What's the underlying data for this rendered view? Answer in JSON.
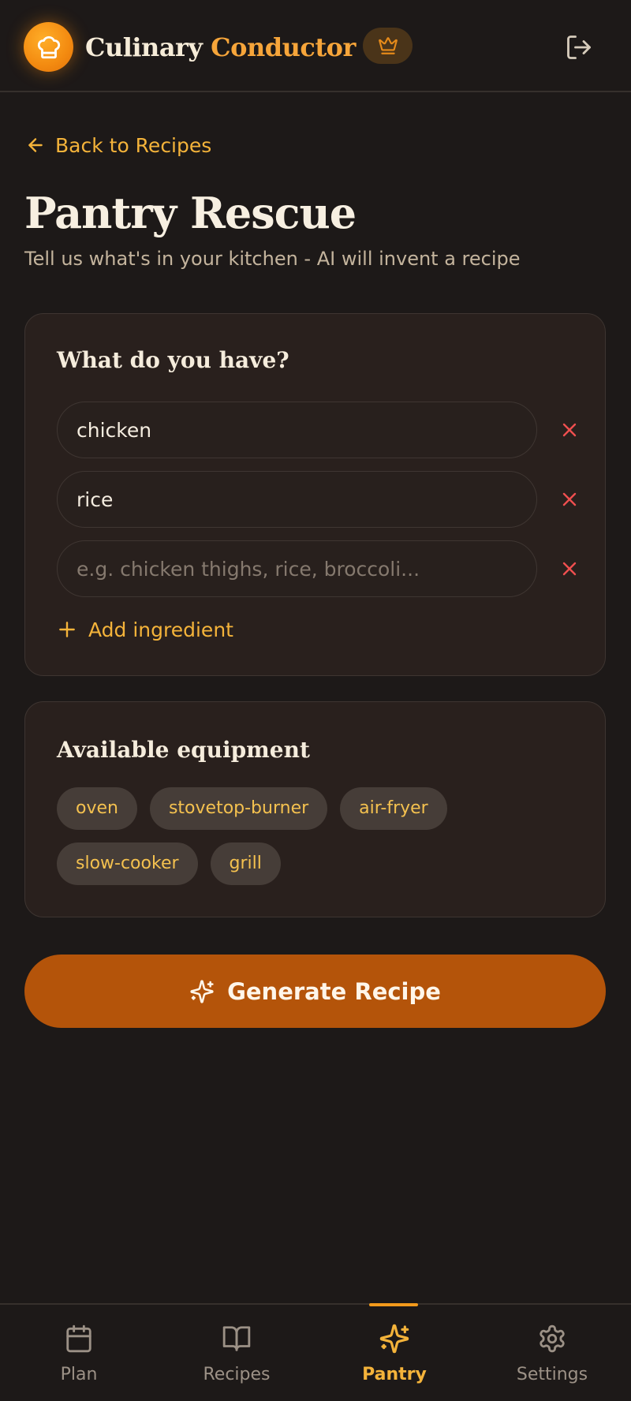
{
  "header": {
    "brand_primary": "Culinary",
    "brand_secondary": "Conductor",
    "logo_icon": "chef-hat-icon",
    "badge_icon": "crown-icon",
    "logout_icon": "logout-icon"
  },
  "back_link": {
    "label": "Back to Recipes",
    "icon": "arrow-left-icon"
  },
  "page": {
    "title": "Pantry Rescue",
    "subtitle": "Tell us what's in your kitchen - AI will invent a recipe"
  },
  "ingredients": {
    "title": "What do you have?",
    "items": [
      {
        "value": "chicken",
        "placeholder": ""
      },
      {
        "value": "rice",
        "placeholder": ""
      },
      {
        "value": "",
        "placeholder": "e.g. chicken thighs, rice, broccoli..."
      }
    ],
    "add_label": "Add ingredient"
  },
  "equipment": {
    "title": "Available equipment",
    "chips": [
      "oven",
      "stovetop-burner",
      "air-fryer",
      "slow-cooker",
      "grill"
    ]
  },
  "generate": {
    "label": "Generate Recipe",
    "icon": "sparkles-icon"
  },
  "nav": {
    "items": [
      {
        "label": "Plan",
        "icon": "calendar-icon",
        "active": false
      },
      {
        "label": "Recipes",
        "icon": "book-open-icon",
        "active": false
      },
      {
        "label": "Pantry",
        "icon": "sparkles-icon",
        "active": true
      },
      {
        "label": "Settings",
        "icon": "gear-icon",
        "active": false
      }
    ]
  },
  "colors": {
    "background": "#1d1918",
    "card": "#29201d",
    "accent": "#f4b33a",
    "brand_orange": "#f6a53a",
    "button": "#b4540a",
    "remove": "#ef4f4f"
  }
}
